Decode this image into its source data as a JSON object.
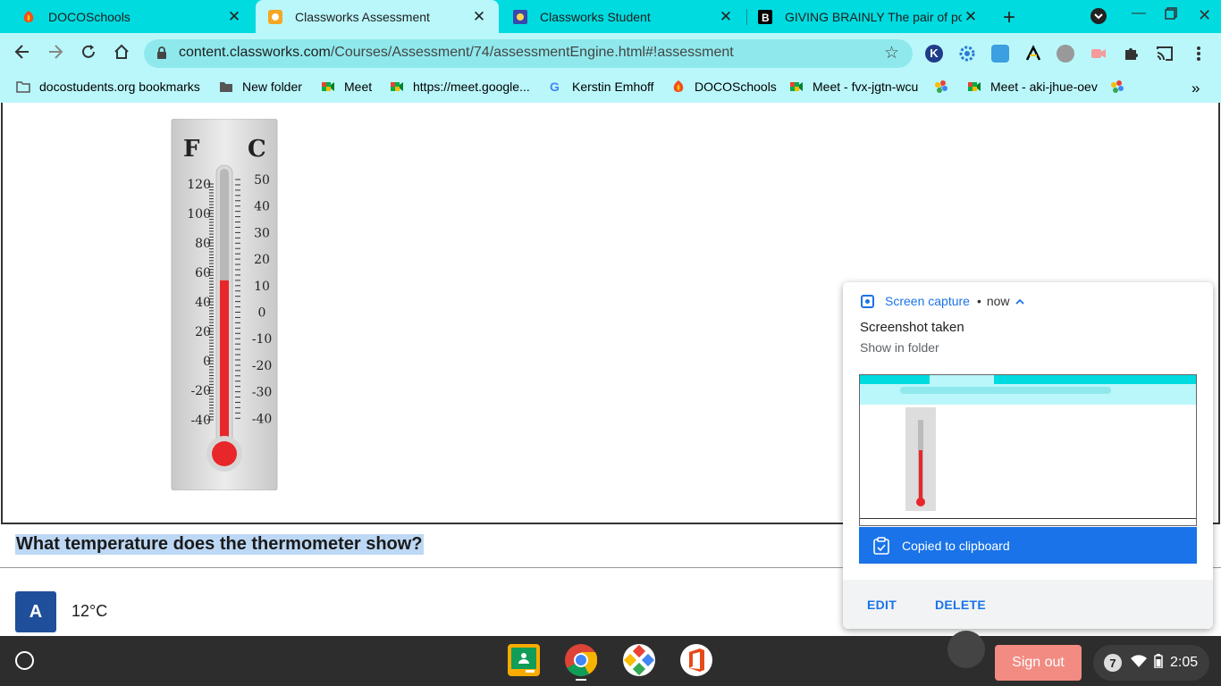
{
  "browser": {
    "tabs": [
      {
        "label": "DOCOSchools",
        "active": false
      },
      {
        "label": "Classworks Assessment",
        "active": true
      },
      {
        "label": "Classworks Student",
        "active": false
      },
      {
        "label": "GIVING BRAINLY The pair of poly",
        "active": false
      }
    ],
    "url_host": "content.classworks.com",
    "url_path": "/Courses/Assessment/74/assessmentEngine.html#!assessment",
    "bookmarks": [
      {
        "label": "docostudents.org bookmarks",
        "icon": "folder-icon"
      },
      {
        "label": "New folder",
        "icon": "folder-icon"
      },
      {
        "label": "Meet",
        "icon": "meet-icon"
      },
      {
        "label": "https://meet.google...",
        "icon": "meet-icon"
      },
      {
        "label": "Kerstin Emhoff",
        "icon": "google-icon"
      },
      {
        "label": "DOCOSchools",
        "icon": "docoschools-icon"
      },
      {
        "label": "Meet - fvx-jgtn-wcu",
        "icon": "meet-icon"
      },
      {
        "label": "Meet - aki-jhue-oev",
        "icon": "meet-icon"
      }
    ],
    "overflow_label": "»"
  },
  "thermometer": {
    "f_label": "F",
    "c_label": "C",
    "f_ticks": [
      "120",
      "100",
      "80",
      "60",
      "40",
      "20",
      "0",
      "-20",
      "-40"
    ],
    "c_ticks": [
      "50",
      "40",
      "30",
      "20",
      "10",
      "0",
      "-10",
      "-20",
      "-30",
      "-40"
    ],
    "reading_c": 12
  },
  "question": {
    "text": "What temperature does the thermometer show?",
    "options": [
      {
        "letter": "A",
        "text": "12°C"
      }
    ]
  },
  "notification": {
    "source": "Screen capture",
    "time": "now",
    "title": "Screenshot taken",
    "subtitle": "Show in folder",
    "copied": "Copied to clipboard",
    "edit": "EDIT",
    "delete": "DELETE"
  },
  "shelf": {
    "sign_out": "Sign out",
    "notification_count": "7",
    "clock": "2:05"
  },
  "colors": {
    "tabstrip": "#00dbe0",
    "toolbar": "#baf7fb",
    "accent": "#1a73e8",
    "mercury": "#e8272b"
  }
}
